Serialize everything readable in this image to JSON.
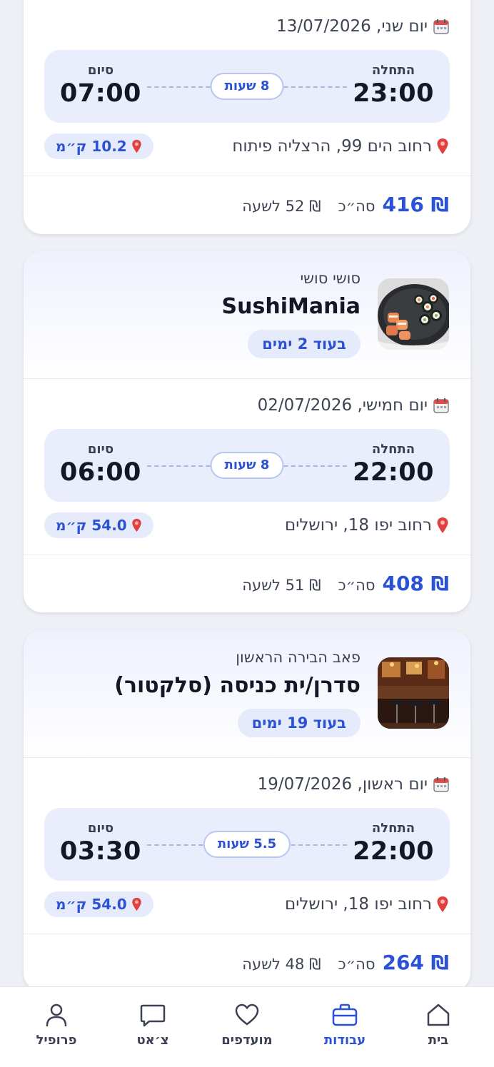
{
  "cards": [
    {
      "date": "יום שני, 13/07/2026",
      "start_label": "התחלה",
      "start_time": "23:00",
      "end_label": "סיום",
      "end_time": "07:00",
      "duration": "8 שעות",
      "address": "רחוב הים 99, הרצליה פיתוח",
      "distance": "10.2 ק״מ",
      "total": "416",
      "total_label": "סה״כ",
      "rate": "52 לשעה",
      "currency": "₪"
    },
    {
      "business": "סושי סושי",
      "title": "SushiMania",
      "days": "בעוד 2 ימים",
      "thumb_icon": "sushi-photo",
      "date": "יום חמישי, 02/07/2026",
      "start_label": "התחלה",
      "start_time": "22:00",
      "end_label": "סיום",
      "end_time": "06:00",
      "duration": "8 שעות",
      "address": "רחוב יפו 18, ירושלים",
      "distance": "54.0 ק״מ",
      "total": "408",
      "total_label": "סה״כ",
      "rate": "51 לשעה",
      "currency": "₪"
    },
    {
      "business": "פאב הבירה הראשון",
      "title": "סדרן/ית כניסה (סלקטור)",
      "days": "בעוד 19 ימים",
      "thumb_icon": "pub-photo",
      "date": "יום ראשון, 19/07/2026",
      "start_label": "התחלה",
      "start_time": "22:00",
      "end_label": "סיום",
      "end_time": "03:30",
      "duration": "5.5 שעות",
      "address": "רחוב יפו 18, ירושלים",
      "distance": "54.0 ק״מ",
      "total": "264",
      "total_label": "סה״כ",
      "rate": "48 לשעה",
      "currency": "₪"
    }
  ],
  "tabs": [
    {
      "label": "בית",
      "icon": "home-icon"
    },
    {
      "label": "עבודות",
      "icon": "briefcase-icon",
      "active": true
    },
    {
      "label": "מועדפים",
      "icon": "heart-icon"
    },
    {
      "label": "צ׳אט",
      "icon": "chat-icon"
    },
    {
      "label": "פרופיל",
      "icon": "profile-icon"
    }
  ],
  "colors": {
    "accent": "#2b52d4",
    "background": "#eef0f5",
    "time_box": "#e9edfc"
  }
}
